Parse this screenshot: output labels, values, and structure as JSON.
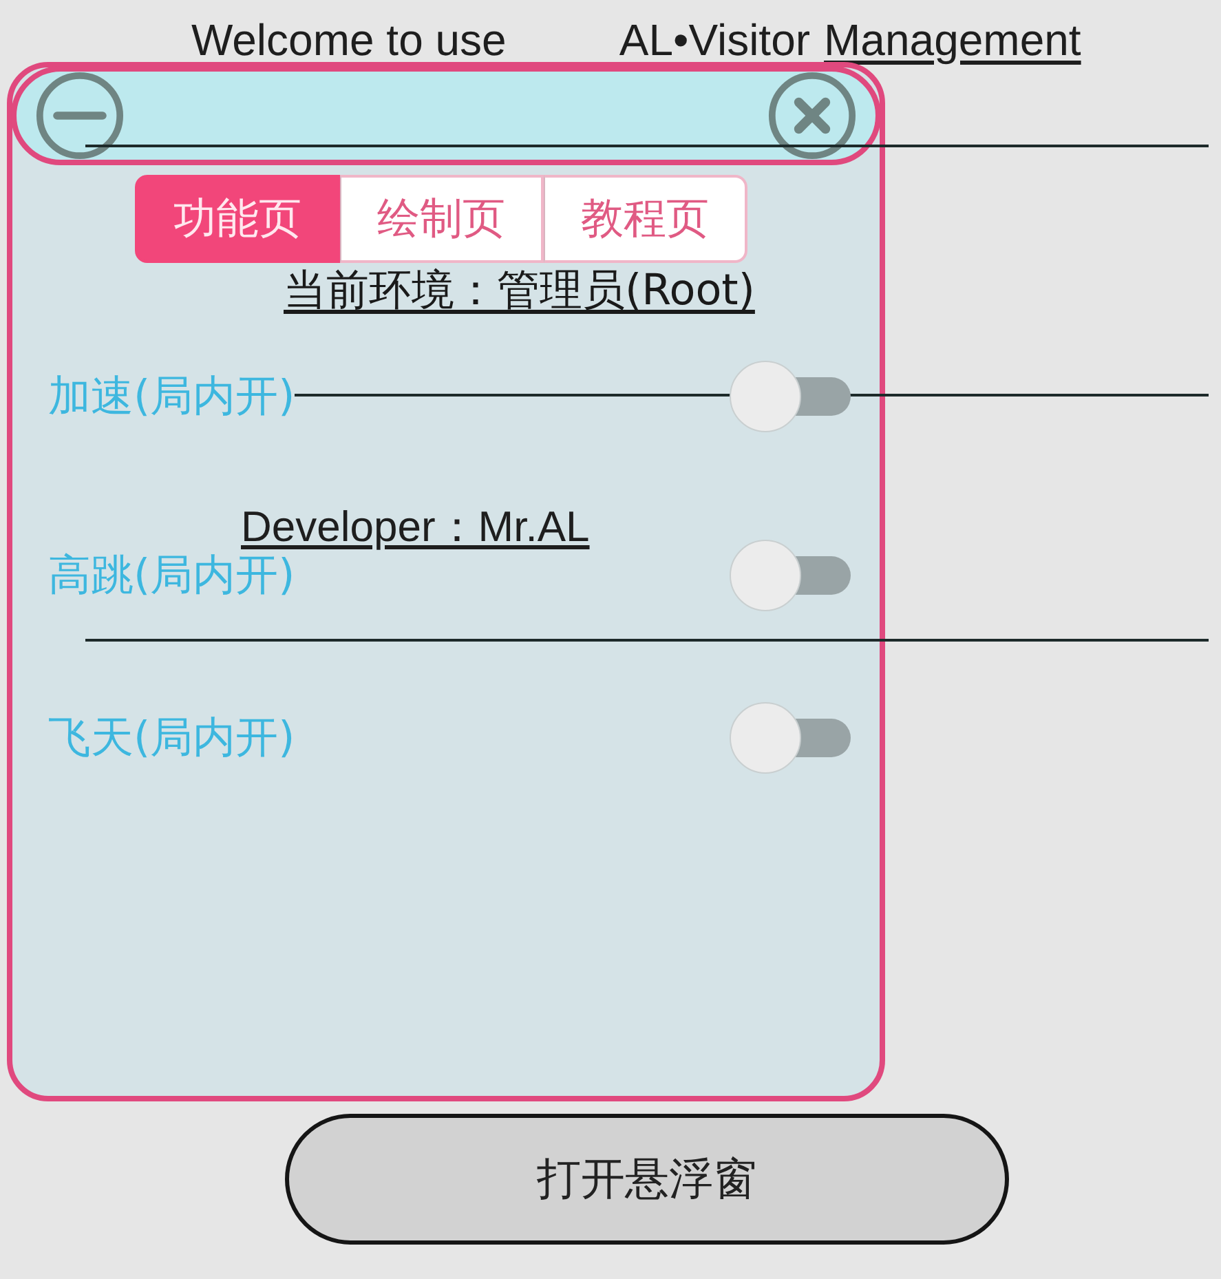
{
  "heading": {
    "welcome": "Welcome to use",
    "app_name": [
      {
        "text": "AL•Visitor",
        "underlined": false
      },
      {
        "text": "Management",
        "underlined": true
      }
    ]
  },
  "developer": "Developer：Mr.AL",
  "floating_window": {
    "tabs": [
      {
        "label": "功能页",
        "selected": true
      },
      {
        "label": "绘制页",
        "selected": false
      },
      {
        "label": "教程页",
        "selected": false
      }
    ],
    "environment": "当前环境：管理员(Root)",
    "switches": [
      {
        "label": "加速(局内开)",
        "on": false
      },
      {
        "label": "高跳(局内开)",
        "on": false
      },
      {
        "label": "飞天(局内开)",
        "on": false
      }
    ]
  },
  "open_button": {
    "label": "打开悬浮窗"
  }
}
